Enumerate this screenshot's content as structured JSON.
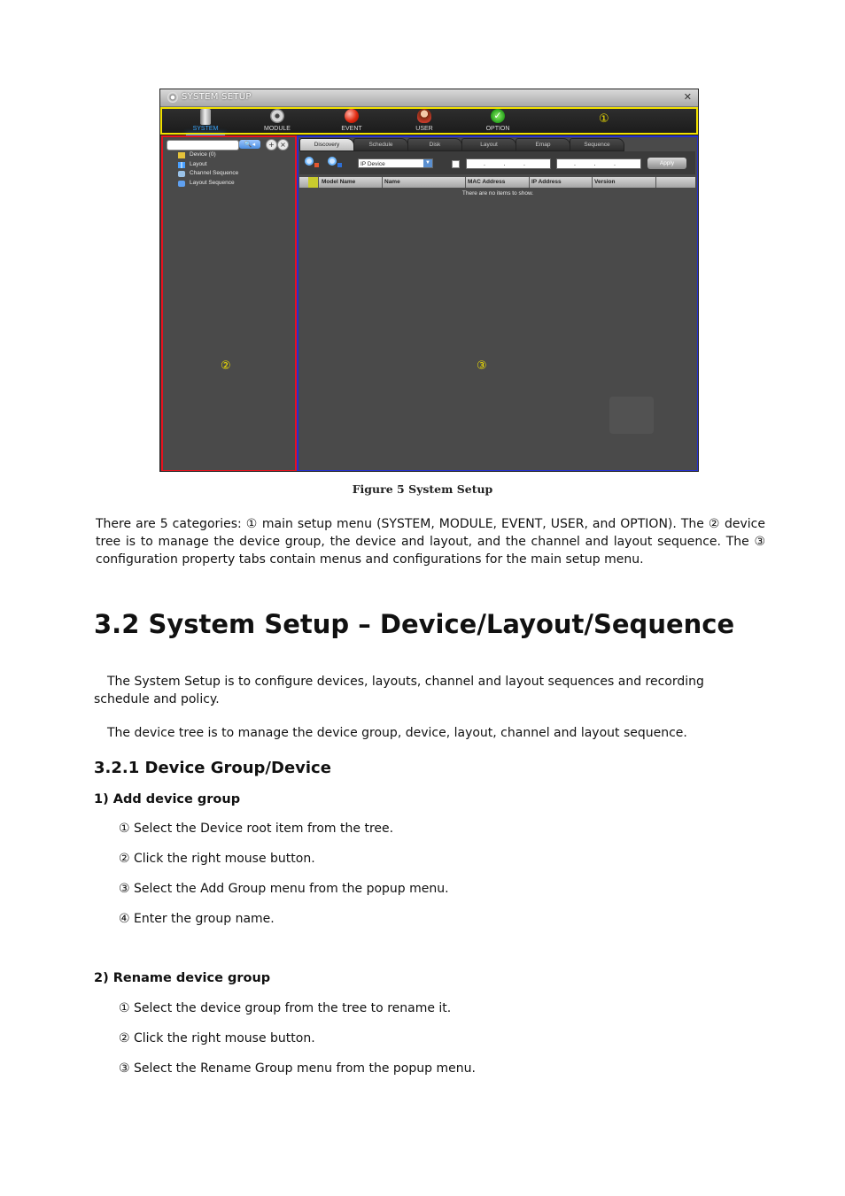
{
  "screenshot": {
    "title": "SYSTEM SETUP",
    "close": "✕",
    "menu": [
      {
        "label": "SYSTEM",
        "icon": "server-icon",
        "active": true
      },
      {
        "label": "MODULE",
        "icon": "gears-icon",
        "active": false
      },
      {
        "label": "EVENT",
        "icon": "alarm-light-icon",
        "active": false
      },
      {
        "label": "USER",
        "icon": "user-icon",
        "active": false
      },
      {
        "label": "OPTION",
        "icon": "check-icon",
        "active": false
      }
    ],
    "markers": {
      "one": "①",
      "two": "②",
      "three": "③"
    },
    "tree": [
      {
        "label": "Device (0)",
        "icon": "folder-icon"
      },
      {
        "label": "Layout",
        "icon": "grid-icon"
      },
      {
        "label": "Channel Sequence",
        "icon": "camera-sequence-icon"
      },
      {
        "label": "Layout Sequence",
        "icon": "layout-sequence-icon"
      }
    ],
    "tabs": [
      "Discovery",
      "Schedule",
      "Disk",
      "Layout",
      "Emap",
      "Sequence"
    ],
    "active_tab": "Discovery",
    "device_type_select": "IP Device",
    "ip_start": ". . .",
    "ip_end": ". . .",
    "apply_label": "Apply",
    "columns": [
      "Model Name",
      "Name",
      "MAC Address",
      "IP Address",
      "Version"
    ],
    "empty_message": "There are no items to show."
  },
  "caption": "Figure 5 System Setup",
  "intro_paragraph": "There are 5 categories: ① main setup menu (SYSTEM, MODULE, EVENT, USER, and OPTION). The ② device tree is to manage the device group, the device and layout, and the channel and layout sequence. The ③ configuration property tabs contain menus and configurations for the main setup menu.",
  "section_heading": "3.2 System Setup – Device/Layout/Sequence",
  "section_p1": "The System Setup is to configure devices, layouts, channel and layout sequences and recording schedule and policy.",
  "section_p2": "The device tree is to manage the device group, device, layout, channel and layout sequence.",
  "subsection_heading": "3.2.1 Device Group/Device",
  "add_group": {
    "heading": "1) Add device group",
    "steps": [
      "① Select the Device root item from the tree.",
      "② Click the right mouse button.",
      "③ Select the Add Group menu from the popup menu.",
      "④ Enter the group name."
    ]
  },
  "rename_group": {
    "heading": "2) Rename device group",
    "steps": [
      "① Select the device group from the tree to rename it.",
      "② Click the right mouse button.",
      "③ Select the Rename Group menu from the popup menu."
    ]
  }
}
